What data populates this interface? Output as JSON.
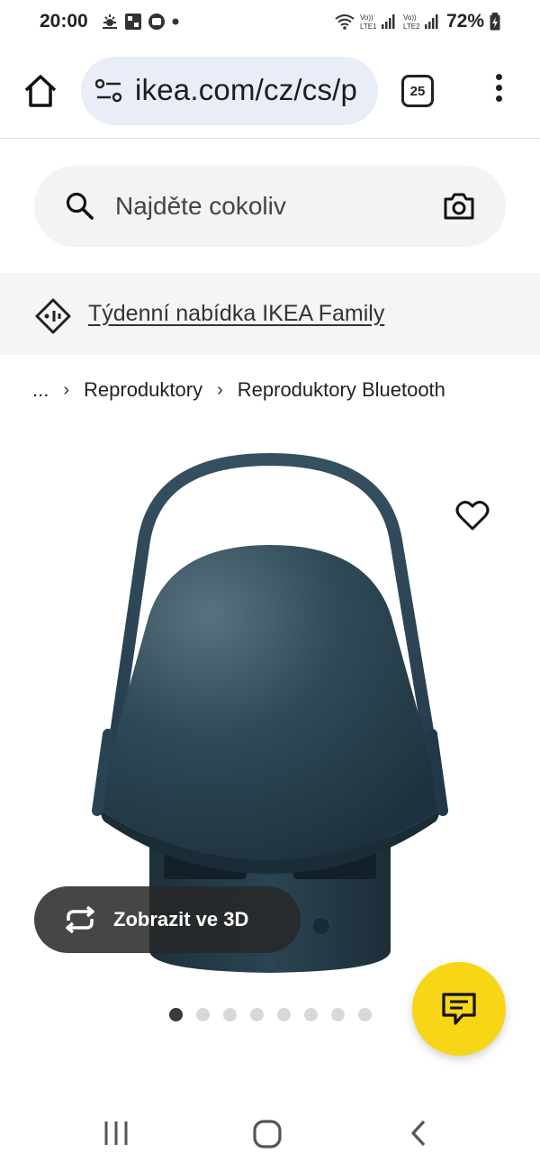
{
  "status_bar": {
    "time": "20:00",
    "battery": "72%",
    "sim1_label": "Vo)) LTE1",
    "sim2_label": "Vo)) LTE2"
  },
  "browser": {
    "url": "ikea.com/cz/cs/p",
    "tab_count": "25",
    "icons": [
      "home-icon",
      "site-settings-icon",
      "tabs-icon",
      "more-vert-icon"
    ]
  },
  "search": {
    "placeholder": "Najděte cokoliv",
    "value": ""
  },
  "family_banner": {
    "label": "Týdenní nabídka IKEA Family"
  },
  "breadcrumb": {
    "ellipsis": "...",
    "separator": "›",
    "items": [
      "Reproduktory",
      "Reproduktory Bluetooth"
    ]
  },
  "product": {
    "view_3d_label": "Zobrazit ve 3D",
    "image_count": 8,
    "active_image_index": 0,
    "speaker_color": "#2c4654"
  },
  "colors": {
    "chat_button": "#f7d616",
    "url_pill": "#e9edf7",
    "search_bg": "#f3f3f3",
    "banner_bg": "#f5f5f5"
  }
}
